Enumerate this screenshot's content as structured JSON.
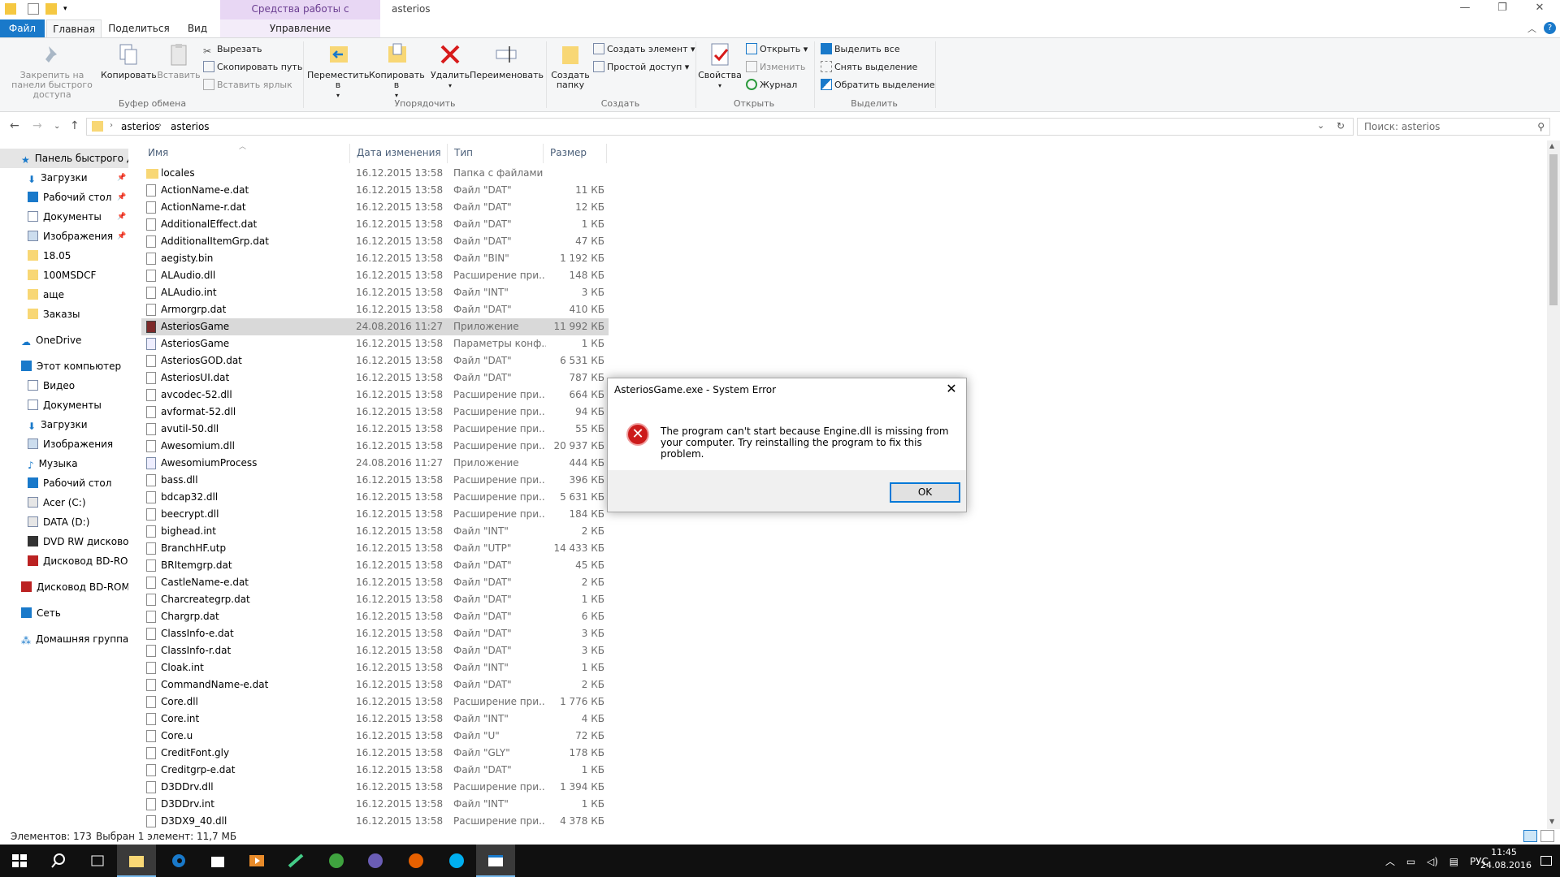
{
  "window": {
    "title": "asterios",
    "context_band": "Средства работы с приложениями",
    "minimize": "—",
    "maximize": "❐",
    "close": "✕"
  },
  "tabs": {
    "file": "Файл",
    "home": "Главная",
    "share": "Поделиться",
    "view": "Вид",
    "manage": "Управление"
  },
  "ribbon": {
    "clipboard": {
      "label": "Буфер обмена",
      "pin": "Закрепить на панели быстрого доступа",
      "copy": "Копировать",
      "paste": "Вставить",
      "cut": "Вырезать",
      "copy_path": "Скопировать путь",
      "paste_shortcut": "Вставить ярлык"
    },
    "organize": {
      "label": "Упорядочить",
      "move": "Переместить в",
      "copy_to": "Копировать в",
      "delete": "Удалить",
      "rename": "Переименовать"
    },
    "create": {
      "label": "Создать",
      "new_folder": "Создать папку",
      "new_item": "Создать элемент",
      "easy_access": "Простой доступ"
    },
    "open": {
      "label": "Открыть",
      "properties": "Свойства",
      "open": "Открыть",
      "edit": "Изменить",
      "history": "Журнал"
    },
    "select": {
      "label": "Выделить",
      "select_all": "Выделить все",
      "select_none": "Снять выделение",
      "invert": "Обратить выделение"
    }
  },
  "address": {
    "crumbs": [
      "asterios",
      "asterios"
    ],
    "search_placeholder": "Поиск: asterios"
  },
  "nav": {
    "quick_access": "Панель быстрого доступа",
    "items": [
      {
        "label": "Загрузки",
        "pinned": true
      },
      {
        "label": "Рабочий стол",
        "pinned": true
      },
      {
        "label": "Документы",
        "pinned": true
      },
      {
        "label": "Изображения",
        "pinned": true
      },
      {
        "label": "18.05",
        "pinned": false
      },
      {
        "label": "100MSDCF",
        "pinned": false
      },
      {
        "label": "аще",
        "pinned": false
      },
      {
        "label": "Заказы",
        "pinned": false
      }
    ],
    "onedrive": "OneDrive",
    "this_pc": "Этот компьютер",
    "pc_items": [
      "Видео",
      "Документы",
      "Загрузки",
      "Изображения",
      "Музыка",
      "Рабочий стол",
      "Acer (C:)",
      "DATA (D:)",
      "DVD RW дисковод (",
      "Дисковод BD-ROM"
    ],
    "bd_drive": "Дисковод BD-ROM (",
    "network": "Сеть",
    "homegroup": "Домашняя группа"
  },
  "columns": {
    "name": "Имя",
    "date": "Дата изменения",
    "type": "Тип",
    "size": "Размер"
  },
  "files": [
    {
      "name": "locales",
      "date": "16.12.2015 13:58",
      "type": "Папка с файлами",
      "size": "",
      "icon": "folder"
    },
    {
      "name": "ActionName-e.dat",
      "date": "16.12.2015 13:58",
      "type": "Файл \"DAT\"",
      "size": "11 КБ",
      "icon": "file"
    },
    {
      "name": "ActionName-r.dat",
      "date": "16.12.2015 13:58",
      "type": "Файл \"DAT\"",
      "size": "12 КБ",
      "icon": "file"
    },
    {
      "name": "AdditionalEffect.dat",
      "date": "16.12.2015 13:58",
      "type": "Файл \"DAT\"",
      "size": "1 КБ",
      "icon": "file"
    },
    {
      "name": "AdditionalItemGrp.dat",
      "date": "16.12.2015 13:58",
      "type": "Файл \"DAT\"",
      "size": "47 КБ",
      "icon": "file"
    },
    {
      "name": "aegisty.bin",
      "date": "16.12.2015 13:58",
      "type": "Файл \"BIN\"",
      "size": "1 192 КБ",
      "icon": "file"
    },
    {
      "name": "ALAudio.dll",
      "date": "16.12.2015 13:58",
      "type": "Расширение при...",
      "size": "148 КБ",
      "icon": "file"
    },
    {
      "name": "ALAudio.int",
      "date": "16.12.2015 13:58",
      "type": "Файл \"INT\"",
      "size": "3 КБ",
      "icon": "file"
    },
    {
      "name": "Armorgrp.dat",
      "date": "16.12.2015 13:58",
      "type": "Файл \"DAT\"",
      "size": "410 КБ",
      "icon": "file"
    },
    {
      "name": "AsteriosGame",
      "date": "24.08.2016 11:27",
      "type": "Приложение",
      "size": "11 992 КБ",
      "icon": "app",
      "selected": true
    },
    {
      "name": "AsteriosGame",
      "date": "16.12.2015 13:58",
      "type": "Параметры конф...",
      "size": "1 КБ",
      "icon": "cfg"
    },
    {
      "name": "AsteriosGOD.dat",
      "date": "16.12.2015 13:58",
      "type": "Файл \"DAT\"",
      "size": "6 531 КБ",
      "icon": "file"
    },
    {
      "name": "AsteriosUI.dat",
      "date": "16.12.2015 13:58",
      "type": "Файл \"DAT\"",
      "size": "787 КБ",
      "icon": "file"
    },
    {
      "name": "avcodec-52.dll",
      "date": "16.12.2015 13:58",
      "type": "Расширение при...",
      "size": "664 КБ",
      "icon": "file"
    },
    {
      "name": "avformat-52.dll",
      "date": "16.12.2015 13:58",
      "type": "Расширение при...",
      "size": "94 КБ",
      "icon": "file"
    },
    {
      "name": "avutil-50.dll",
      "date": "16.12.2015 13:58",
      "type": "Расширение при...",
      "size": "55 КБ",
      "icon": "file"
    },
    {
      "name": "Awesomium.dll",
      "date": "16.12.2015 13:58",
      "type": "Расширение при...",
      "size": "20 937 КБ",
      "icon": "file"
    },
    {
      "name": "AwesomiumProcess",
      "date": "24.08.2016 11:27",
      "type": "Приложение",
      "size": "444 КБ",
      "icon": "cfg"
    },
    {
      "name": "bass.dll",
      "date": "16.12.2015 13:58",
      "type": "Расширение при...",
      "size": "396 КБ",
      "icon": "file"
    },
    {
      "name": "bdcap32.dll",
      "date": "16.12.2015 13:58",
      "type": "Расширение при...",
      "size": "5 631 КБ",
      "icon": "file"
    },
    {
      "name": "beecrypt.dll",
      "date": "16.12.2015 13:58",
      "type": "Расширение при...",
      "size": "184 КБ",
      "icon": "file"
    },
    {
      "name": "bighead.int",
      "date": "16.12.2015 13:58",
      "type": "Файл \"INT\"",
      "size": "2 КБ",
      "icon": "file"
    },
    {
      "name": "BranchHF.utp",
      "date": "16.12.2015 13:58",
      "type": "Файл \"UTP\"",
      "size": "14 433 КБ",
      "icon": "file"
    },
    {
      "name": "BRItemgrp.dat",
      "date": "16.12.2015 13:58",
      "type": "Файл \"DAT\"",
      "size": "45 КБ",
      "icon": "file"
    },
    {
      "name": "CastleName-e.dat",
      "date": "16.12.2015 13:58",
      "type": "Файл \"DAT\"",
      "size": "2 КБ",
      "icon": "file"
    },
    {
      "name": "Charcreategrp.dat",
      "date": "16.12.2015 13:58",
      "type": "Файл \"DAT\"",
      "size": "1 КБ",
      "icon": "file"
    },
    {
      "name": "Chargrp.dat",
      "date": "16.12.2015 13:58",
      "type": "Файл \"DAT\"",
      "size": "6 КБ",
      "icon": "file"
    },
    {
      "name": "ClassInfo-e.dat",
      "date": "16.12.2015 13:58",
      "type": "Файл \"DAT\"",
      "size": "3 КБ",
      "icon": "file"
    },
    {
      "name": "ClassInfo-r.dat",
      "date": "16.12.2015 13:58",
      "type": "Файл \"DAT\"",
      "size": "3 КБ",
      "icon": "file"
    },
    {
      "name": "Cloak.int",
      "date": "16.12.2015 13:58",
      "type": "Файл \"INT\"",
      "size": "1 КБ",
      "icon": "file"
    },
    {
      "name": "CommandName-e.dat",
      "date": "16.12.2015 13:58",
      "type": "Файл \"DAT\"",
      "size": "2 КБ",
      "icon": "file"
    },
    {
      "name": "Core.dll",
      "date": "16.12.2015 13:58",
      "type": "Расширение при...",
      "size": "1 776 КБ",
      "icon": "file"
    },
    {
      "name": "Core.int",
      "date": "16.12.2015 13:58",
      "type": "Файл \"INT\"",
      "size": "4 КБ",
      "icon": "file"
    },
    {
      "name": "Core.u",
      "date": "16.12.2015 13:58",
      "type": "Файл \"U\"",
      "size": "72 КБ",
      "icon": "file"
    },
    {
      "name": "CreditFont.gly",
      "date": "16.12.2015 13:58",
      "type": "Файл \"GLY\"",
      "size": "178 КБ",
      "icon": "file"
    },
    {
      "name": "Creditgrp-e.dat",
      "date": "16.12.2015 13:58",
      "type": "Файл \"DAT\"",
      "size": "1 КБ",
      "icon": "file"
    },
    {
      "name": "D3DDrv.dll",
      "date": "16.12.2015 13:58",
      "type": "Расширение при...",
      "size": "1 394 КБ",
      "icon": "file"
    },
    {
      "name": "D3DDrv.int",
      "date": "16.12.2015 13:58",
      "type": "Файл \"INT\"",
      "size": "1 КБ",
      "icon": "file"
    },
    {
      "name": "D3DX9_40.dll",
      "date": "16.12.2015 13:58",
      "type": "Расширение при...",
      "size": "4 378 КБ",
      "icon": "file"
    }
  ],
  "status": {
    "count": "Элементов: 173",
    "selection": "Выбран 1 элемент: 11,7 МБ"
  },
  "dialog": {
    "title": "AsteriosGame.exe - System Error",
    "message": "The program can't start because Engine.dll is missing from your computer. Try reinstalling the program to fix this problem.",
    "ok": "OK",
    "close": "✕"
  },
  "taskbar": {
    "lang": "РУС",
    "time": "11:45",
    "date": "24.08.2016"
  }
}
